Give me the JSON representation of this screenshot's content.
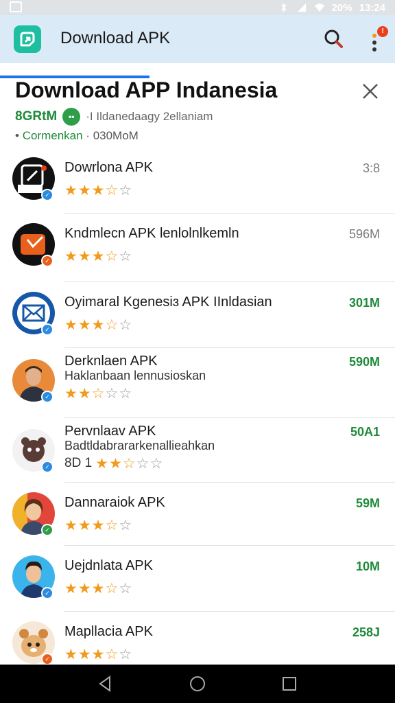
{
  "status_bar": {
    "battery": "20%",
    "time": "13:24"
  },
  "app_bar": {
    "title": "Download APK",
    "badge": "!"
  },
  "header": {
    "title": "Download APP Indanesia",
    "rating_label": "8GRtM",
    "dot_label": "••",
    "subtitle": "·I Ildanedaagy 2ellaniam",
    "category": "Cormenkan",
    "category_prefix": "•",
    "downloads": "030MoM"
  },
  "apps": [
    {
      "title": "Dowrlona APK",
      "subtitle": "",
      "size": "3:8",
      "size_color": "#7a7a7a",
      "rating": 3.5,
      "rating_text": "",
      "avatar": "download",
      "badge_color": "#2a8be0"
    },
    {
      "title": "Kndmlecn APK  lenlolnlkemln",
      "subtitle": "",
      "size": "596M",
      "size_color": "#7a7a7a",
      "rating": 3.5,
      "rating_text": "",
      "avatar": "orange",
      "badge_color": "#e8601c"
    },
    {
      "title": "Oyimaral Kgenesiɜ APK IInldasian",
      "subtitle": "",
      "size": "301M",
      "size_color": "#1f8a3a",
      "rating": 3.5,
      "rating_text": "",
      "avatar": "mail",
      "badge_color": "#2a8be0"
    },
    {
      "title": "Derknlaen APK",
      "subtitle": "Haklanbaan lennusioskan",
      "size": "590M",
      "size_color": "#1f8a3a",
      "rating": 2.5,
      "rating_text": "",
      "avatar": "man-suit",
      "badge_color": "#2a8be0"
    },
    {
      "title": "Pervnlaav APK",
      "subtitle": "Badtldabrararkenallieahkan",
      "size": "50A1",
      "size_color": "#1f8a3a",
      "rating": 2.5,
      "rating_text": "8D 1",
      "avatar": "bear",
      "badge_color": "#2a8be0"
    },
    {
      "title": "Dannaraiok APK",
      "subtitle": "",
      "size": "59M",
      "size_color": "#1f8a3a",
      "rating": 3.5,
      "rating_text": "",
      "avatar": "woman",
      "badge_color": "#2e9e48"
    },
    {
      "title": "Uejdnlata APK",
      "subtitle": "",
      "size": "10M",
      "size_color": "#1f8a3a",
      "rating": 3.5,
      "rating_text": "",
      "avatar": "man-blue",
      "badge_color": "#2a8be0"
    },
    {
      "title": "Mapllacia APK",
      "subtitle": "",
      "size": "258J",
      "size_color": "#1f8a3a",
      "rating": 3.5,
      "rating_text": "",
      "avatar": "creature",
      "badge_color": "#e8601c"
    }
  ],
  "colors": {
    "accent": "#1a73e8",
    "star": "#f29a1b",
    "green": "#1f8a3a",
    "app_bar_bg": "#dbeaf7",
    "logo": "#1ebfa1"
  },
  "icons": [
    "search-icon",
    "more-vert-icon",
    "close-icon",
    "back-icon",
    "home-icon",
    "recents-icon",
    "verified-icon",
    "star-icon"
  ]
}
